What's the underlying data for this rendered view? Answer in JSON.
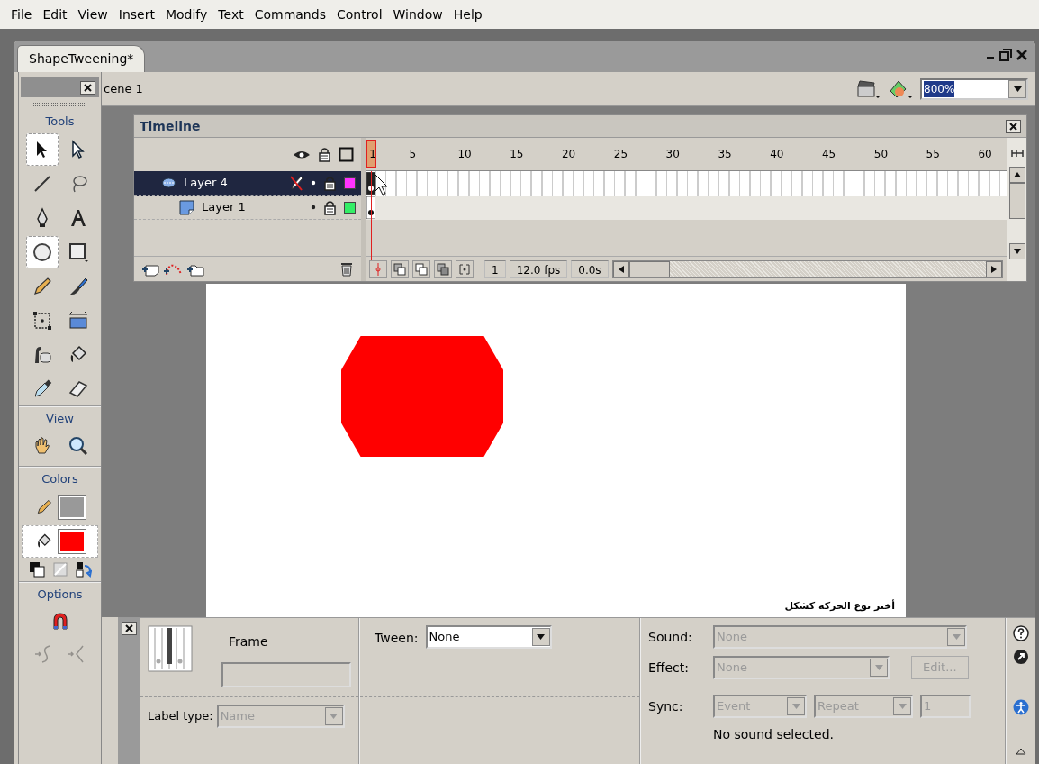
{
  "menu": [
    "File",
    "Edit",
    "View",
    "Insert",
    "Modify",
    "Text",
    "Commands",
    "Control",
    "Window",
    "Help"
  ],
  "document": {
    "tab": "ShapeTweening*",
    "scene": "cene 1",
    "zoom": "800%"
  },
  "tools": {
    "title": "Tools",
    "items": [
      {
        "kind": "arrow",
        "selected": true
      },
      {
        "kind": "subselect",
        "selected": false
      },
      {
        "kind": "line",
        "selected": false
      },
      {
        "kind": "lasso",
        "selected": false
      },
      {
        "kind": "pen",
        "selected": false
      },
      {
        "kind": "text",
        "selected": false
      },
      {
        "kind": "oval",
        "selected": true
      },
      {
        "kind": "rectangle",
        "selected": false
      },
      {
        "kind": "pencil",
        "selected": false
      },
      {
        "kind": "brush",
        "selected": false
      },
      {
        "kind": "transform",
        "selected": false
      },
      {
        "kind": "fill-transform",
        "selected": false
      },
      {
        "kind": "ink-bottle",
        "selected": false
      },
      {
        "kind": "bucket",
        "selected": false
      },
      {
        "kind": "eyedropper",
        "selected": false
      },
      {
        "kind": "eraser",
        "selected": false
      }
    ]
  },
  "view": {
    "title": "View",
    "items": [
      {
        "kind": "hand",
        "selected": false
      },
      {
        "kind": "zoom",
        "selected": false
      }
    ]
  },
  "colors": {
    "title": "Colors",
    "stroke": {
      "color": "#999999",
      "selected": false
    },
    "fill": {
      "color": "#ff0000",
      "selected": true
    }
  },
  "options": {
    "title": "Options",
    "items": [
      {
        "kind": "magnet",
        "disabled": false
      },
      {
        "kind": "smooth",
        "disabled": true
      },
      {
        "kind": "straighten",
        "disabled": true
      }
    ]
  },
  "timeline": {
    "title": "Timeline",
    "ruler": [
      "1",
      "5",
      "10",
      "15",
      "20",
      "25",
      "30",
      "35",
      "40",
      "45",
      "50",
      "55",
      "60"
    ],
    "layers": [
      {
        "name": "Layer 4",
        "kind": "guide",
        "selected": true,
        "editing": true,
        "color": "#ff33ff",
        "children": [
          {
            "name": "Layer 1",
            "kind": "normal",
            "selected": false,
            "editing": false,
            "color": "#33ee66"
          }
        ]
      }
    ],
    "frame": "1",
    "fps": "12.0 fps",
    "time": "0.0s"
  },
  "stage": {
    "caption": "أختر نوع الحركه كشكل"
  },
  "properties": {
    "frame_label": "Frame",
    "label_type": {
      "label": "Label type:",
      "value": "Name",
      "disabled": true
    },
    "tween": {
      "label": "Tween:",
      "value": "None",
      "disabled": false
    },
    "sound": {
      "label": "Sound:",
      "value": "None",
      "disabled": true
    },
    "effect": {
      "label": "Effect:",
      "value": "None",
      "disabled": true
    },
    "edit": {
      "label": "Edit...",
      "disabled": true
    },
    "sync": {
      "label": "Sync:",
      "value": "Event",
      "disabled": true
    },
    "repeat": {
      "value": "Repeat",
      "disabled": true
    },
    "repeat_count": {
      "value": "1",
      "disabled": true
    },
    "status": "No sound selected."
  }
}
